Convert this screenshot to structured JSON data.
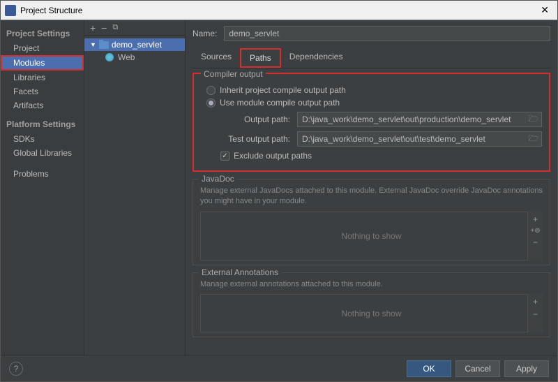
{
  "window": {
    "title": "Project Structure"
  },
  "sidebar": {
    "group1_title": "Project Settings",
    "group1_items": [
      "Project",
      "Modules",
      "Libraries",
      "Facets",
      "Artifacts"
    ],
    "group2_title": "Platform Settings",
    "group2_items": [
      "SDKs",
      "Global Libraries"
    ],
    "group3_items": [
      "Problems"
    ]
  },
  "tree": {
    "module": "demo_servlet",
    "sub": "Web"
  },
  "main": {
    "name_label": "Name:",
    "name_value": "demo_servlet",
    "tabs": [
      "Sources",
      "Paths",
      "Dependencies"
    ],
    "compiler": {
      "title": "Compiler output",
      "inherit": "Inherit project compile output path",
      "use_module": "Use module compile output path",
      "output_label": "Output path:",
      "output_value": "D:\\java_work\\demo_servlet\\out\\production\\demo_servlet",
      "test_label": "Test output path:",
      "test_value": "D:\\java_work\\demo_servlet\\out\\test\\demo_servlet",
      "exclude": "Exclude output paths"
    },
    "javadoc": {
      "title": "JavaDoc",
      "desc": "Manage external JavaDocs attached to this module. External JavaDoc override JavaDoc annotations you might have in your module.",
      "empty": "Nothing to show"
    },
    "ext": {
      "title": "External Annotations",
      "desc": "Manage external annotations attached to this module.",
      "empty": "Nothing to show"
    }
  },
  "footer": {
    "ok": "OK",
    "cancel": "Cancel",
    "apply": "Apply"
  }
}
